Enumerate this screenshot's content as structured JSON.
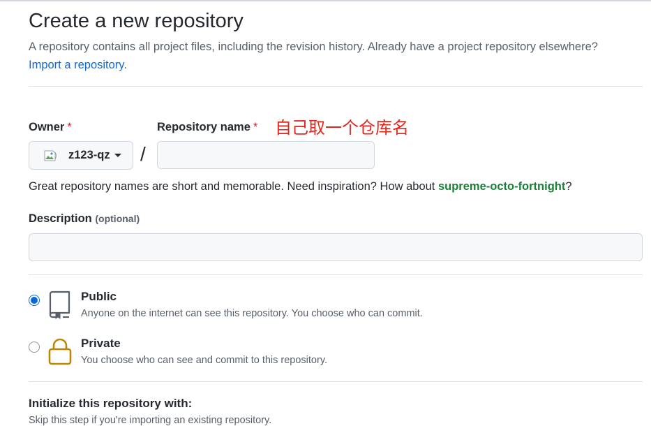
{
  "header": {
    "title": "Create a new repository",
    "subtitle": "A repository contains all project files, including the revision history. Already have a project repository elsewhere?",
    "import_link": "Import a repository."
  },
  "owner": {
    "label": "Owner",
    "required_mark": "*",
    "username": "z123-qz",
    "avatar_alt": "@"
  },
  "repo_name": {
    "label": "Repository name",
    "required_mark": "*",
    "value": "",
    "annotation": "自己取一个仓库名"
  },
  "separator": "/",
  "name_hint": {
    "text": "Great repository names are short and memorable. Need inspiration? How about ",
    "suggestion": "supreme-octo-fortnight",
    "suffix": "?"
  },
  "description": {
    "label": "Description",
    "optional": "(optional)",
    "value": ""
  },
  "visibility": {
    "selected": "public",
    "options": [
      {
        "id": "public",
        "title": "Public",
        "desc": "Anyone on the internet can see this repository. You choose who can commit.",
        "icon": "repo-icon",
        "icon_color": "#57606a"
      },
      {
        "id": "private",
        "title": "Private",
        "desc": "You choose who can see and commit to this repository.",
        "icon": "lock-icon",
        "icon_color": "#bf8700"
      }
    ]
  },
  "initialize": {
    "label": "Initialize this repository with:",
    "partial_text": "Skip this step if you're importing an existing repository."
  },
  "colors": {
    "link": "#0969da",
    "suggestion": "#1a7f37",
    "required": "#cf222e",
    "annotation": "#e3261c"
  }
}
